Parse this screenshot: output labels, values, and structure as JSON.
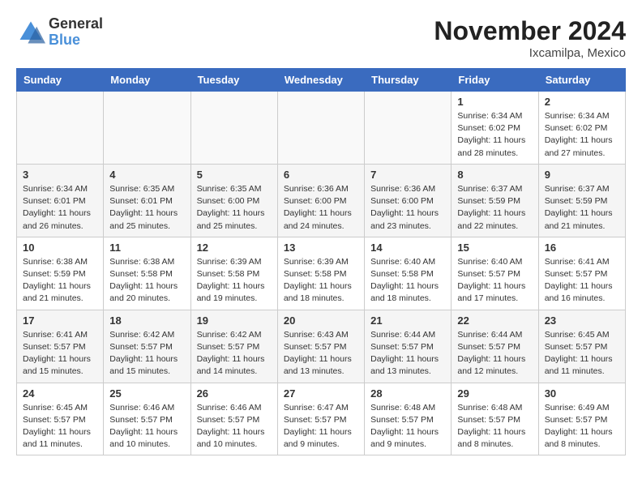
{
  "header": {
    "logo_line1": "General",
    "logo_line2": "Blue",
    "month_title": "November 2024",
    "location": "Ixcamilpa, Mexico"
  },
  "weekdays": [
    "Sunday",
    "Monday",
    "Tuesday",
    "Wednesday",
    "Thursday",
    "Friday",
    "Saturday"
  ],
  "weeks": [
    [
      {
        "day": "",
        "info": ""
      },
      {
        "day": "",
        "info": ""
      },
      {
        "day": "",
        "info": ""
      },
      {
        "day": "",
        "info": ""
      },
      {
        "day": "",
        "info": ""
      },
      {
        "day": "1",
        "info": "Sunrise: 6:34 AM\nSunset: 6:02 PM\nDaylight: 11 hours and 28 minutes."
      },
      {
        "day": "2",
        "info": "Sunrise: 6:34 AM\nSunset: 6:02 PM\nDaylight: 11 hours and 27 minutes."
      }
    ],
    [
      {
        "day": "3",
        "info": "Sunrise: 6:34 AM\nSunset: 6:01 PM\nDaylight: 11 hours and 26 minutes."
      },
      {
        "day": "4",
        "info": "Sunrise: 6:35 AM\nSunset: 6:01 PM\nDaylight: 11 hours and 25 minutes."
      },
      {
        "day": "5",
        "info": "Sunrise: 6:35 AM\nSunset: 6:00 PM\nDaylight: 11 hours and 25 minutes."
      },
      {
        "day": "6",
        "info": "Sunrise: 6:36 AM\nSunset: 6:00 PM\nDaylight: 11 hours and 24 minutes."
      },
      {
        "day": "7",
        "info": "Sunrise: 6:36 AM\nSunset: 6:00 PM\nDaylight: 11 hours and 23 minutes."
      },
      {
        "day": "8",
        "info": "Sunrise: 6:37 AM\nSunset: 5:59 PM\nDaylight: 11 hours and 22 minutes."
      },
      {
        "day": "9",
        "info": "Sunrise: 6:37 AM\nSunset: 5:59 PM\nDaylight: 11 hours and 21 minutes."
      }
    ],
    [
      {
        "day": "10",
        "info": "Sunrise: 6:38 AM\nSunset: 5:59 PM\nDaylight: 11 hours and 21 minutes."
      },
      {
        "day": "11",
        "info": "Sunrise: 6:38 AM\nSunset: 5:58 PM\nDaylight: 11 hours and 20 minutes."
      },
      {
        "day": "12",
        "info": "Sunrise: 6:39 AM\nSunset: 5:58 PM\nDaylight: 11 hours and 19 minutes."
      },
      {
        "day": "13",
        "info": "Sunrise: 6:39 AM\nSunset: 5:58 PM\nDaylight: 11 hours and 18 minutes."
      },
      {
        "day": "14",
        "info": "Sunrise: 6:40 AM\nSunset: 5:58 PM\nDaylight: 11 hours and 18 minutes."
      },
      {
        "day": "15",
        "info": "Sunrise: 6:40 AM\nSunset: 5:57 PM\nDaylight: 11 hours and 17 minutes."
      },
      {
        "day": "16",
        "info": "Sunrise: 6:41 AM\nSunset: 5:57 PM\nDaylight: 11 hours and 16 minutes."
      }
    ],
    [
      {
        "day": "17",
        "info": "Sunrise: 6:41 AM\nSunset: 5:57 PM\nDaylight: 11 hours and 15 minutes."
      },
      {
        "day": "18",
        "info": "Sunrise: 6:42 AM\nSunset: 5:57 PM\nDaylight: 11 hours and 15 minutes."
      },
      {
        "day": "19",
        "info": "Sunrise: 6:42 AM\nSunset: 5:57 PM\nDaylight: 11 hours and 14 minutes."
      },
      {
        "day": "20",
        "info": "Sunrise: 6:43 AM\nSunset: 5:57 PM\nDaylight: 11 hours and 13 minutes."
      },
      {
        "day": "21",
        "info": "Sunrise: 6:44 AM\nSunset: 5:57 PM\nDaylight: 11 hours and 13 minutes."
      },
      {
        "day": "22",
        "info": "Sunrise: 6:44 AM\nSunset: 5:57 PM\nDaylight: 11 hours and 12 minutes."
      },
      {
        "day": "23",
        "info": "Sunrise: 6:45 AM\nSunset: 5:57 PM\nDaylight: 11 hours and 11 minutes."
      }
    ],
    [
      {
        "day": "24",
        "info": "Sunrise: 6:45 AM\nSunset: 5:57 PM\nDaylight: 11 hours and 11 minutes."
      },
      {
        "day": "25",
        "info": "Sunrise: 6:46 AM\nSunset: 5:57 PM\nDaylight: 11 hours and 10 minutes."
      },
      {
        "day": "26",
        "info": "Sunrise: 6:46 AM\nSunset: 5:57 PM\nDaylight: 11 hours and 10 minutes."
      },
      {
        "day": "27",
        "info": "Sunrise: 6:47 AM\nSunset: 5:57 PM\nDaylight: 11 hours and 9 minutes."
      },
      {
        "day": "28",
        "info": "Sunrise: 6:48 AM\nSunset: 5:57 PM\nDaylight: 11 hours and 9 minutes."
      },
      {
        "day": "29",
        "info": "Sunrise: 6:48 AM\nSunset: 5:57 PM\nDaylight: 11 hours and 8 minutes."
      },
      {
        "day": "30",
        "info": "Sunrise: 6:49 AM\nSunset: 5:57 PM\nDaylight: 11 hours and 8 minutes."
      }
    ]
  ]
}
